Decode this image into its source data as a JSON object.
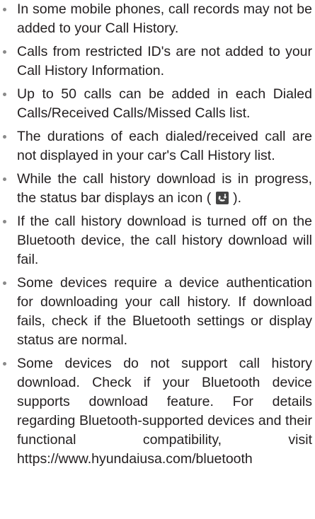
{
  "items": [
    {
      "text": "In some mobile phones, call records may not be added to your Call History."
    },
    {
      "text": "Calls from restricted ID's are not added to your Call History Information."
    },
    {
      "text": "Up to 50 calls can be added in each Dialed Calls/Received Calls/Missed Calls list."
    },
    {
      "text": "The durations of each dialed/received call are not displayed in your car's Call History list."
    },
    {
      "text_before": "While the call history download is in progress, the status bar displays an icon ( ",
      "icon": "call-history-download-icon",
      "text_after": " )."
    },
    {
      "text": "If the call history download is turned off on the Bluetooth device, the call history download will fail."
    },
    {
      "text": "Some devices require a device authentication for downloading your call history. If download fails, check if the Bluetooth settings or display status are normal."
    },
    {
      "text": "Some devices do not support call history download. Check if your Bluetooth device supports download feature. For details regarding Bluetooth-supported devices and their functional compatibility, visit https://www.hyundaiusa.com/bluetooth"
    }
  ],
  "colors": {
    "text": "#231f20",
    "bullet": "#8a8a8a",
    "icon_background": "#444444",
    "icon_foreground": "#ffffff"
  }
}
